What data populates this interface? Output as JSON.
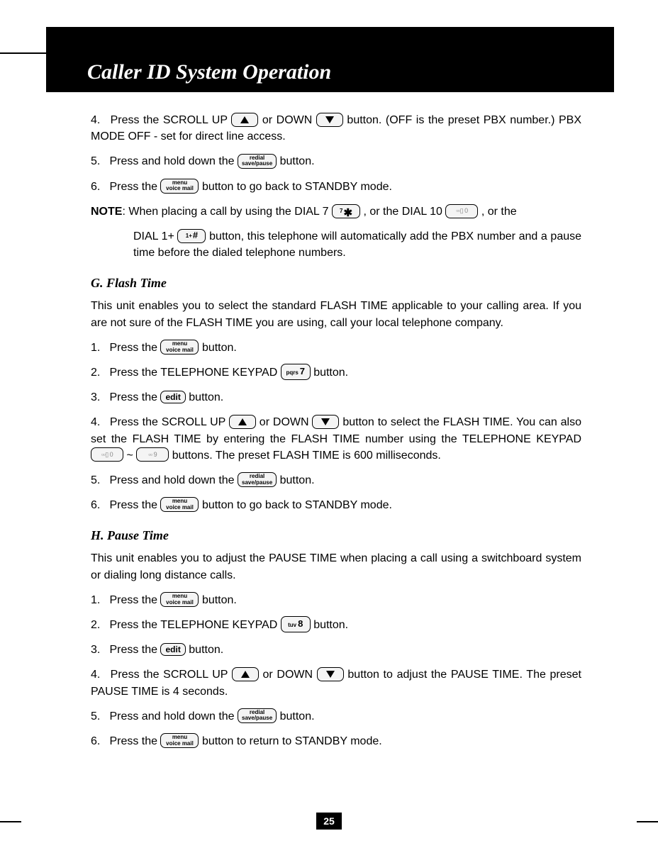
{
  "title": "Caller ID System Operation",
  "page_number": "25",
  "buttons": {
    "redial_top": "redial",
    "redial_bot": "save/pause",
    "menu_top": "menu",
    "menu_bot": "voice mail",
    "edit": "edit",
    "key7_sub": "pqrs",
    "key7_num": "7",
    "key8_sub": "tuv",
    "key8_num": "8",
    "star_sub": "7",
    "star_sym": "✱",
    "hash_sub": "1+",
    "hash_sym": "#",
    "blur0": "▫▫▯ 0",
    "blur9": "▫▫ 9"
  },
  "top": {
    "s4_a": "Press the SCROLL UP ",
    "s4_b": " or DOWN ",
    "s4_c": " button. (OFF is the preset PBX number.) PBX MODE OFF - set for direct line access.",
    "s5_a": "Press and hold down the ",
    "s5_b": " button.",
    "s6_a": "Press the ",
    "s6_b": " button to go back to STANDBY mode.",
    "note_label": "NOTE",
    "note_a": ":  When placing a call by using the DIAL 7 ",
    "note_b": " , or the DIAL 10 ",
    "note_c": " , or the",
    "note2_a": "DIAL 1+ ",
    "note2_b": " button, this telephone will automatically add the PBX number and a pause time before the dialed telephone numbers."
  },
  "g": {
    "head": "G. Flash Time",
    "intro": "This unit enables you to select the standard FLASH TIME applicable to your calling area. If you are not sure of the FLASH TIME you are using, call your local telephone company.",
    "s1_a": "Press the ",
    "s1_b": " button.",
    "s2_a": "Press the TELEPHONE KEYPAD ",
    "s2_b": " button.",
    "s3_a": "Press the ",
    "s3_b": " button.",
    "s4_a": "Press the SCROLL UP ",
    "s4_b": " or DOWN ",
    "s4_c": " button to select the FLASH TIME. You can also set the FLASH TIME by entering the FLASH TIME number using the TELEPHONE KEYPAD ",
    "s4_d": " ~ ",
    "s4_e": " buttons. The preset FLASH TIME is 600 milliseconds.",
    "s5_a": "Press and hold down the ",
    "s5_b": " button.",
    "s6_a": "Press the ",
    "s6_b": " button to go back to STANDBY mode."
  },
  "h": {
    "head": "H. Pause Time",
    "intro": "This unit enables you to adjust the PAUSE TIME when placing a call using a switchboard system or dialing long distance calls.",
    "s1_a": "Press the ",
    "s1_b": " button.",
    "s2_a": "Press the TELEPHONE KEYPAD ",
    "s2_b": " button.",
    "s3_a": "Press the ",
    "s3_b": " button.",
    "s4_a": "Press the SCROLL UP ",
    "s4_b": " or DOWN ",
    "s4_c": " button to adjust the PAUSE TIME. The preset PAUSE TIME is 4 seconds.",
    "s5_a": "Press and hold down the ",
    "s5_b": " button.",
    "s6_a": "Press the ",
    "s6_b": " button to return to STANDBY mode."
  },
  "nums": {
    "n1": "1.",
    "n2": "2.",
    "n3": "3.",
    "n4": "4.",
    "n5": "5.",
    "n6": "6."
  }
}
